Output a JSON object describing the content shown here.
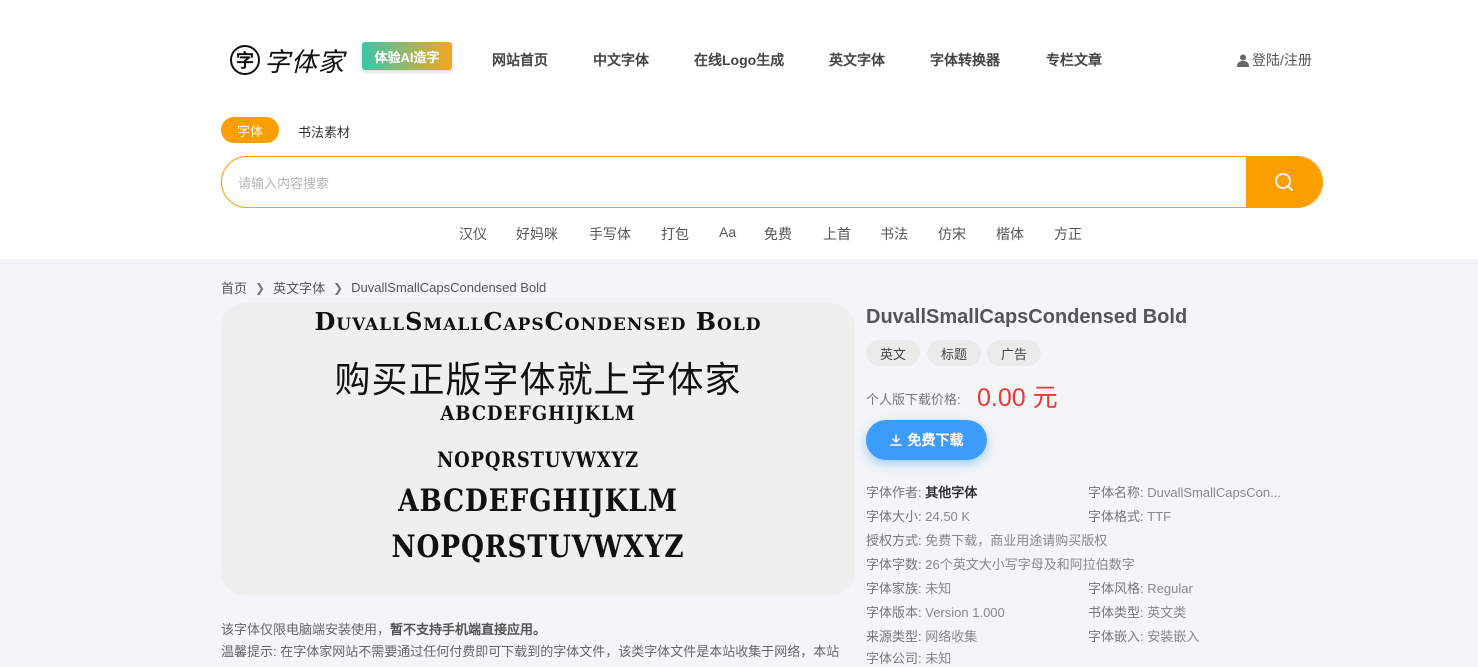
{
  "header": {
    "logo_text": "字体家",
    "ai_badge": "体验AI造字",
    "nav": [
      "网站首页",
      "中文字体",
      "在线Logo生成",
      "英文字体",
      "字体转换器",
      "专栏文章"
    ],
    "login": "登陆/注册"
  },
  "search": {
    "tabs": [
      "字体",
      "书法素材"
    ],
    "placeholder": "请输入内容搜索",
    "hot_words": [
      "汉仪",
      "好妈咪",
      "手写体",
      "打包",
      "Aa",
      "免费",
      "上首",
      "书法",
      "仿宋",
      "楷体",
      "方正"
    ]
  },
  "breadcrumb": [
    "首页",
    "英文字体",
    "DuvallSmallCapsCondensed Bold"
  ],
  "preview": {
    "lines": [
      "DuvallSmallCapsCondensed  Bold",
      "购买正版字体就上字体家",
      "ABCDEFGHIJKLM",
      "NOPQRSTUVWXYZ",
      "ABCDEFGHIJKLM",
      "NOPQRSTUVWXYZ"
    ]
  },
  "notice": {
    "line1_prefix": "该字体仅限电脑端安装使用，",
    "line1_bold": "暂不支持手机端直接应用。",
    "line2": "温馨提示:   在字体家网站不需要通过任何付费即可下载到的字体文件，该类字体文件是本站收集于网络，本站"
  },
  "font": {
    "title": "DuvallSmallCapsCondensed Bold",
    "tags": [
      "英文",
      "标题",
      "广告"
    ],
    "price_label": "个人版下载价格:",
    "price": "0.00 元",
    "download_label": "免费下载",
    "info": [
      {
        "label": "字体作者:",
        "value": "其他字体"
      },
      {
        "label": "字体名称:",
        "value": "DuvallSmallCapsCon..."
      },
      {
        "label": "字体大小:",
        "value": "24.50 K"
      },
      {
        "label": "字体格式:",
        "value": "TTF"
      },
      {
        "label": "授权方式:",
        "value": "免费下载，商业用途请购买版权"
      },
      {
        "label": "字体字数:",
        "value": "26个英文大小写字母及和阿拉伯数字"
      },
      {
        "label": "字体家族:",
        "value": "未知"
      },
      {
        "label": "字体风格:",
        "value": "Regular"
      },
      {
        "label": "字体版本:",
        "value": "Version 1.000"
      },
      {
        "label": "书体类型:",
        "value": "英文类"
      },
      {
        "label": "来源类型:",
        "value": "网络收集"
      },
      {
        "label": "字体嵌入:",
        "value": "安装嵌入"
      },
      {
        "label": "字体公司:",
        "value": "未知"
      }
    ]
  },
  "colors": {
    "accent": "#fc9d00",
    "download": "#3c9cfb",
    "price": "#e53935"
  }
}
